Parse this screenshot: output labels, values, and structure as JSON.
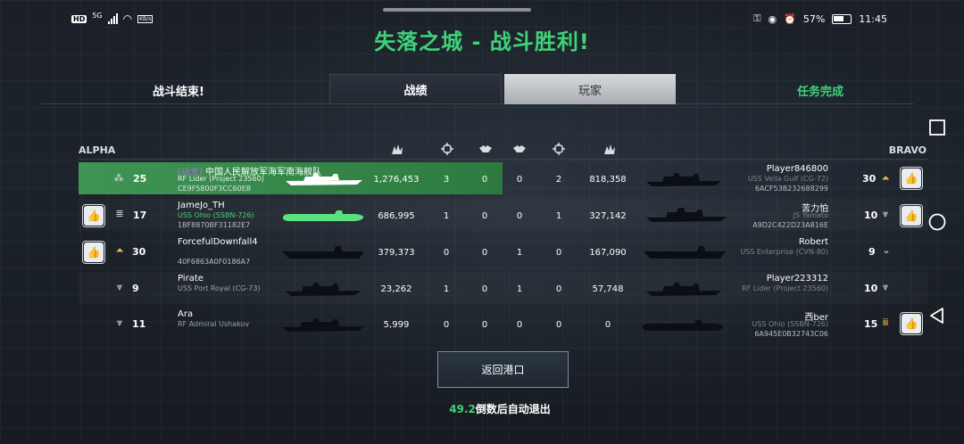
{
  "status_bar": {
    "hd": "HD",
    "net": "5G",
    "speed": "0.00\nKB/s",
    "battery": "57%",
    "time": "11:45"
  },
  "title": "失落之城 - 战斗胜利!",
  "tabs": {
    "battle_end": "战斗结束!",
    "stats": "战绩",
    "players": "玩家",
    "mission": "任务完成"
  },
  "teams": {
    "left": "ALPHA",
    "right": "BRAVO"
  },
  "rows": [
    {
      "l_level": "25",
      "l_clan": "[战龙]",
      "l_name": "中国人民解放军海军南海舰队",
      "l_ship": "RF Lider (Project 23560)",
      "l_id": "CE9F5800F3CC60EB",
      "l_damage": "1,276,453",
      "l_kills": "3",
      "l_assists": "0",
      "r_assists": "0",
      "r_kills": "2",
      "r_damage": "818,358",
      "r_name": "Player846800",
      "r_ship": "USS Vella Gulf (CG-72)",
      "r_id": "6ACF53B232688299",
      "r_level": "30"
    },
    {
      "l_level": "17",
      "l_clan": "",
      "l_name": "JameJo_TH",
      "l_ship": "USS Ohio (SSBN-726)",
      "l_id": "1BF8870BF31182E7",
      "l_damage": "686,995",
      "l_kills": "1",
      "l_assists": "0",
      "r_assists": "0",
      "r_kills": "1",
      "r_damage": "327,142",
      "r_name": "苦力怕",
      "r_ship": "JS Yamato",
      "r_id": "A9D2C422D23A816E",
      "r_level": "10"
    },
    {
      "l_level": "30",
      "l_clan": "",
      "l_name": "ForcefulDownfall4",
      "l_ship": "",
      "l_id": "40F6863A0F0186A7",
      "l_damage": "379,373",
      "l_kills": "0",
      "l_assists": "0",
      "r_assists": "1",
      "r_kills": "0",
      "r_damage": "167,090",
      "r_name": "Robert",
      "r_ship": "USS Enterprise (CVN-80)",
      "r_id": "",
      "r_level": "9"
    },
    {
      "l_level": "9",
      "l_clan": "",
      "l_name": "Pirate",
      "l_ship": "USS Port Royal (CG-73)",
      "l_id": "",
      "l_damage": "23,262",
      "l_kills": "1",
      "l_assists": "0",
      "r_assists": "1",
      "r_kills": "0",
      "r_damage": "57,748",
      "r_name": "Player223312",
      "r_ship": "RF Lider (Project 23560)",
      "r_id": "",
      "r_level": "10"
    },
    {
      "l_level": "11",
      "l_clan": "",
      "l_name": "Ara",
      "l_ship": "RF Admiral Ushakov",
      "l_id": "",
      "l_damage": "5,999",
      "l_kills": "0",
      "l_assists": "0",
      "r_assists": "0",
      "r_kills": "0",
      "r_damage": "0",
      "r_name": "西ber",
      "r_ship": "USS Ohio (SSBN-726)",
      "r_id": "6A945E0B32743C06",
      "r_level": "15"
    }
  ],
  "back_button": "返回港口",
  "timer": {
    "value": "49.2",
    "text": "倒数后自动退出"
  },
  "colors": {
    "accent": "#3fd27a",
    "highlight_row": "#3a8f51"
  }
}
